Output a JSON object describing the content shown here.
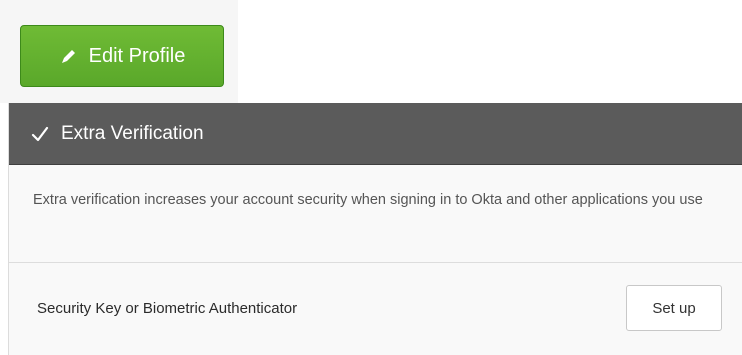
{
  "profile": {
    "edit_button_label": "Edit Profile",
    "edit_icon": "pencil-icon"
  },
  "extra_verification": {
    "header_icon": "checkmark-icon",
    "title": "Extra Verification",
    "description": "Extra verification increases your account security when signing in to Okta and other applications you use",
    "factors": [
      {
        "name": "Security Key or Biometric Authenticator",
        "action_label": "Set up"
      }
    ]
  },
  "colors": {
    "edit_button_green": "#5aa82a",
    "header_gray": "#5b5b5b",
    "panel_background": "#f9f9f9"
  }
}
